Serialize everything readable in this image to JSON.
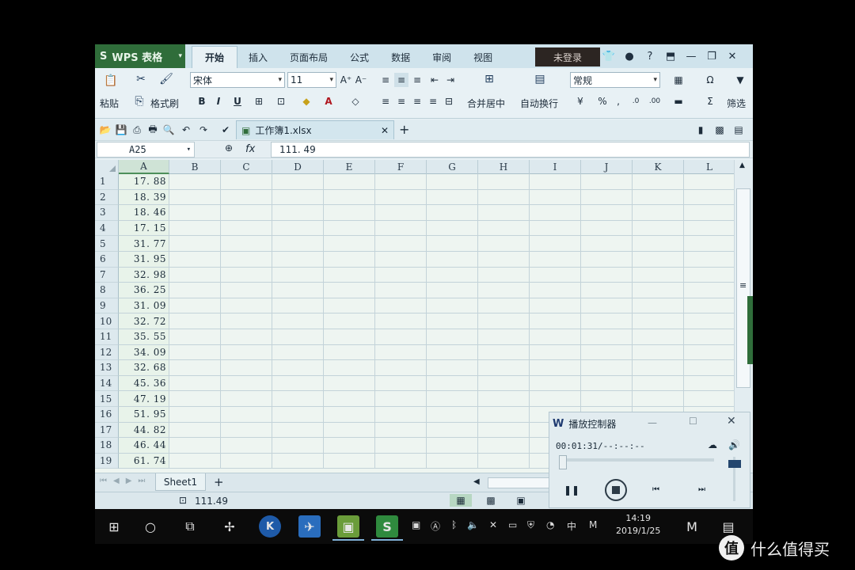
{
  "app": {
    "name": "WPS 表格",
    "logo_glyph": "S",
    "brand_color": "#2f6d3a"
  },
  "menu_tabs": [
    "开始",
    "插入",
    "页面布局",
    "公式",
    "数据",
    "审阅",
    "视图"
  ],
  "active_tab": "开始",
  "login": "未登录",
  "ribbon": {
    "paste": "粘贴",
    "format_painter": "格式刷",
    "font_name": "宋体",
    "font_size": "11",
    "merge_center": "合并居中",
    "wrap_text": "自动换行",
    "number_format": "常规",
    "percent": "%",
    "filter": "筛选",
    "bold": "B",
    "italic": "I",
    "underline": "U"
  },
  "document": {
    "tab_title": "工作簿1.xlsx"
  },
  "formula_bar": {
    "name_box": "A25",
    "fx_label": "fx",
    "formula": "111. 49"
  },
  "columns": [
    "A",
    "B",
    "C",
    "D",
    "E",
    "F",
    "G",
    "H",
    "I",
    "J",
    "K",
    "L"
  ],
  "rows": [
    {
      "n": "1",
      "a": "17. 88"
    },
    {
      "n": "2",
      "a": "18. 39"
    },
    {
      "n": "3",
      "a": "18. 46"
    },
    {
      "n": "4",
      "a": "17. 15"
    },
    {
      "n": "5",
      "a": "31. 77"
    },
    {
      "n": "6",
      "a": "31. 95"
    },
    {
      "n": "7",
      "a": "32. 98"
    },
    {
      "n": "8",
      "a": "36. 25"
    },
    {
      "n": "9",
      "a": "31. 09"
    },
    {
      "n": "10",
      "a": "32. 72"
    },
    {
      "n": "11",
      "a": "35. 55"
    },
    {
      "n": "12",
      "a": "34. 09"
    },
    {
      "n": "13",
      "a": "32. 68"
    },
    {
      "n": "14",
      "a": "45. 36"
    },
    {
      "n": "15",
      "a": "47. 19"
    },
    {
      "n": "16",
      "a": "51. 95"
    },
    {
      "n": "17",
      "a": "44. 82"
    },
    {
      "n": "18",
      "a": "46. 44"
    },
    {
      "n": "19",
      "a": "61. 74"
    }
  ],
  "sheetbar": {
    "sheet_name": "Sheet1",
    "add": "+"
  },
  "statusbar": {
    "value": "111.49"
  },
  "player": {
    "title": "播放控制器",
    "time": "00:01:31/--:--:--"
  },
  "taskbar": {
    "time": "14:19",
    "date": "2019/1/25",
    "ime": "中"
  },
  "watermark": {
    "badge": "值",
    "text": "什么值得买"
  }
}
